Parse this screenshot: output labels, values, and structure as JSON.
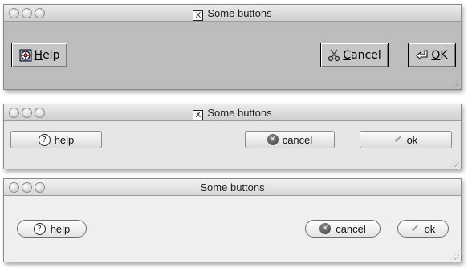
{
  "windows": [
    {
      "title": "Some buttons",
      "buttons": {
        "help": {
          "prefix": "",
          "mnemonic": "H",
          "rest": "elp",
          "icon": "lifebuoy-icon"
        },
        "cancel": {
          "prefix": "",
          "mnemonic": "C",
          "rest": "ancel",
          "icon": "scissors-icon"
        },
        "ok": {
          "prefix": "",
          "mnemonic": "O",
          "rest": "K",
          "icon": "enter-arrow-icon"
        }
      }
    },
    {
      "title": "Some buttons",
      "buttons": {
        "help": {
          "label": "help",
          "icon": "question-icon"
        },
        "cancel": {
          "label": "cancel",
          "icon": "cancel-x-icon"
        },
        "ok": {
          "label": "ok",
          "icon": "checkmark-icon"
        }
      }
    },
    {
      "title": "Some buttons",
      "buttons": {
        "help": {
          "label": "help",
          "icon": "question-icon"
        },
        "cancel": {
          "label": "cancel",
          "icon": "cancel-x-icon"
        },
        "ok": {
          "label": "ok",
          "icon": "checkmark-icon"
        }
      }
    }
  ],
  "colors": {
    "window1_bg": "#bdbdbd",
    "window2_bg": "#e6e6e6",
    "window3_bg": "#efefef"
  }
}
